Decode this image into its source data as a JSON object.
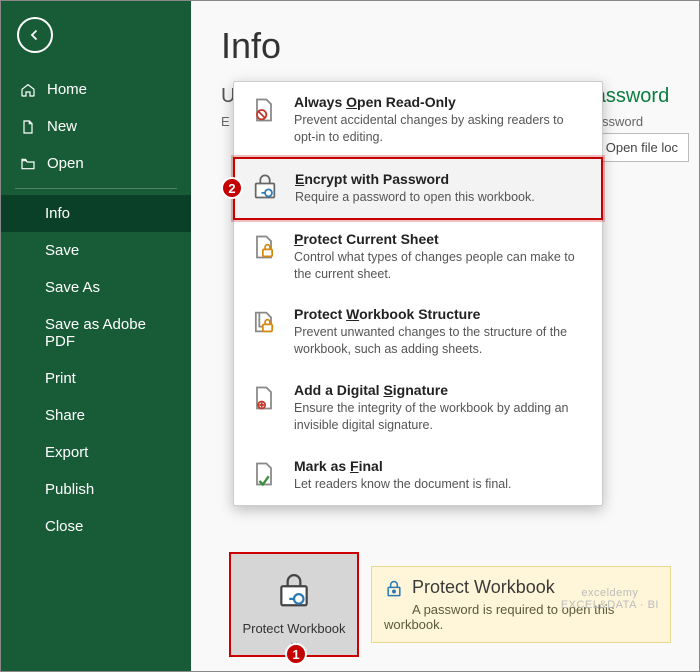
{
  "sidebar": {
    "back": "Back",
    "items": [
      {
        "label": "Home",
        "icon": "home-icon"
      },
      {
        "label": "New",
        "icon": "new-icon"
      },
      {
        "label": "Open",
        "icon": "open-icon"
      }
    ],
    "items2": [
      {
        "label": "Info"
      },
      {
        "label": "Save"
      },
      {
        "label": "Save As"
      },
      {
        "label": "Save as Adobe PDF"
      },
      {
        "label": "Print"
      },
      {
        "label": "Share"
      },
      {
        "label": "Export"
      },
      {
        "label": "Publish"
      },
      {
        "label": "Close"
      }
    ],
    "selected_index": 0
  },
  "page": {
    "title": "Info",
    "under_initial": "U",
    "under_sub_initial": "E",
    "right_label": "assword",
    "right_sub": "assword",
    "open_btn": "Open file loc"
  },
  "menu": {
    "items": [
      {
        "title": "Always Open Read-Only",
        "underline_segment": "O",
        "desc": "Prevent accidental changes by asking readers to opt-in to editing."
      },
      {
        "title": "Encrypt with Password",
        "underline_segment": "E",
        "desc": "Require a password to open this workbook."
      },
      {
        "title": "Protect Current Sheet",
        "underline_segment": "P",
        "desc": "Control what types of changes people can make to the current sheet."
      },
      {
        "title": "Protect Workbook Structure",
        "underline_segment": "W",
        "desc": "Prevent unwanted changes to the structure of the workbook, such as adding sheets."
      },
      {
        "title": "Add a Digital Signature",
        "underline_segment": "S",
        "desc": "Ensure the integrity of the workbook by adding an invisible digital signature."
      },
      {
        "title": "Mark as Final",
        "underline_segment": "F",
        "desc": "Let readers know the document is final."
      }
    ]
  },
  "protect_card": {
    "label": "Protect Workbook"
  },
  "protect_summary": {
    "title": "Protect Workbook",
    "desc": "A password is required to open this workbook."
  },
  "annotations": {
    "step1": "1",
    "step2": "2"
  },
  "watermark": {
    "line1": "exceldemy",
    "line2": "EXCEL&DATA · BI"
  }
}
